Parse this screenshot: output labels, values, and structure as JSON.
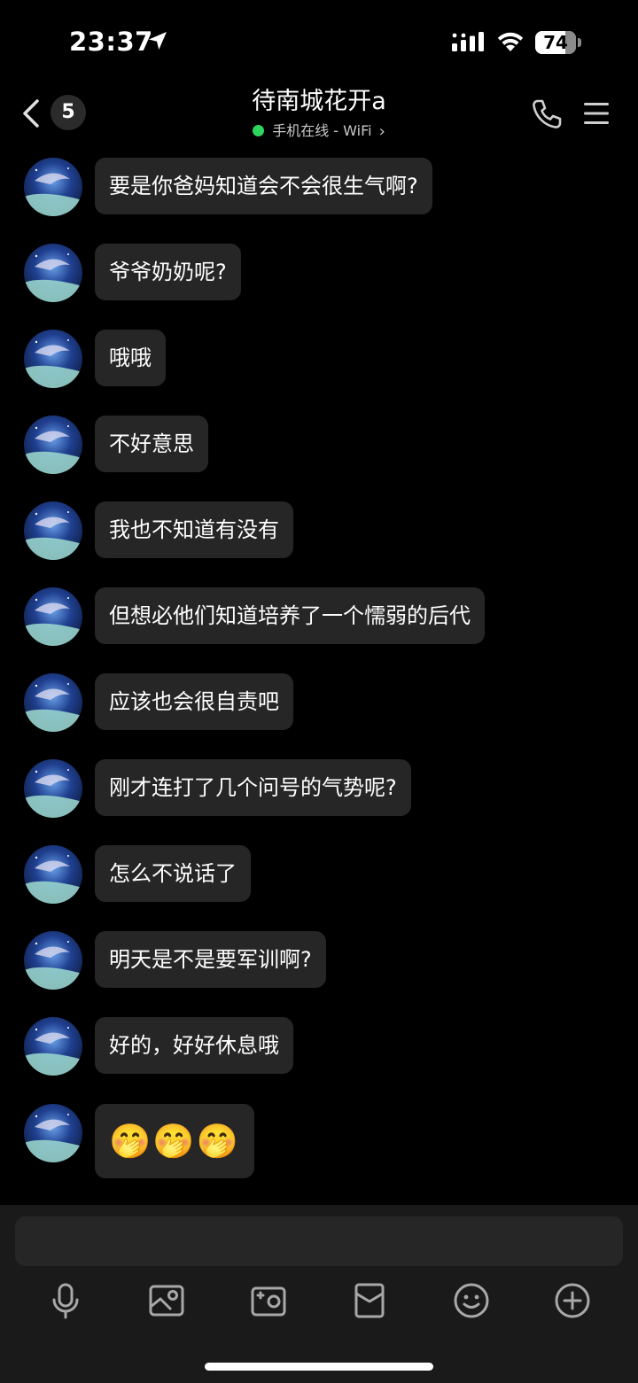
{
  "status_bar": {
    "time": "23:37",
    "battery_level": "74",
    "icons": [
      "location-arrow-icon",
      "signal-icon",
      "wifi-icon",
      "battery-icon"
    ]
  },
  "header": {
    "unread_count": "5",
    "title": "待南城花开a",
    "subtitle": "手机在线 - WiFi",
    "online_color": "#2fd45d",
    "icons": [
      "back-chevron-icon",
      "phone-icon",
      "menu-icon"
    ]
  },
  "messages": [
    {
      "text": "要是你爸妈知道会不会很生气啊?"
    },
    {
      "text": "爷爷奶奶呢?"
    },
    {
      "text": "哦哦"
    },
    {
      "text": "不好意思"
    },
    {
      "text": "我也不知道有没有"
    },
    {
      "text": "但想必他们知道培养了一个懦弱的后代"
    },
    {
      "text": "应该也会很自责吧"
    },
    {
      "text": "刚才连打了几个问号的气势呢?"
    },
    {
      "text": "怎么不说话了"
    },
    {
      "text": "明天是不是要军训啊?"
    },
    {
      "text": "好的，好好休息哦"
    },
    {
      "text": "🤭🤭🤭"
    }
  ],
  "toolbar": {
    "icons": [
      "microphone-icon",
      "image-icon",
      "camera-icon",
      "red-envelope-icon",
      "emoji-icon",
      "plus-icon"
    ]
  },
  "colors": {
    "background": "#000000",
    "bubble": "#262626",
    "panel": "#1a1a1a"
  }
}
